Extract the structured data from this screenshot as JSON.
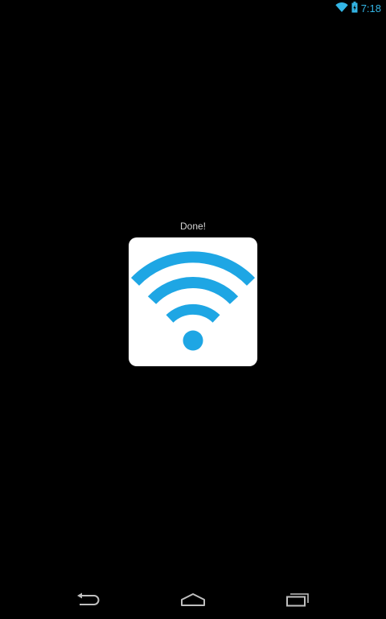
{
  "status_bar": {
    "time": "7:18",
    "icons": [
      "wifi-icon",
      "battery-icon"
    ],
    "accent_color": "#33b5e5"
  },
  "main": {
    "status_text": "Done!",
    "tile_icon": "wifi-icon",
    "tile_color": "#ffffff",
    "icon_color": "#1ea6e4"
  },
  "nav_bar": {
    "icons": [
      "back-icon",
      "home-icon",
      "recents-icon"
    ],
    "icon_color": "#bfbfbf"
  }
}
